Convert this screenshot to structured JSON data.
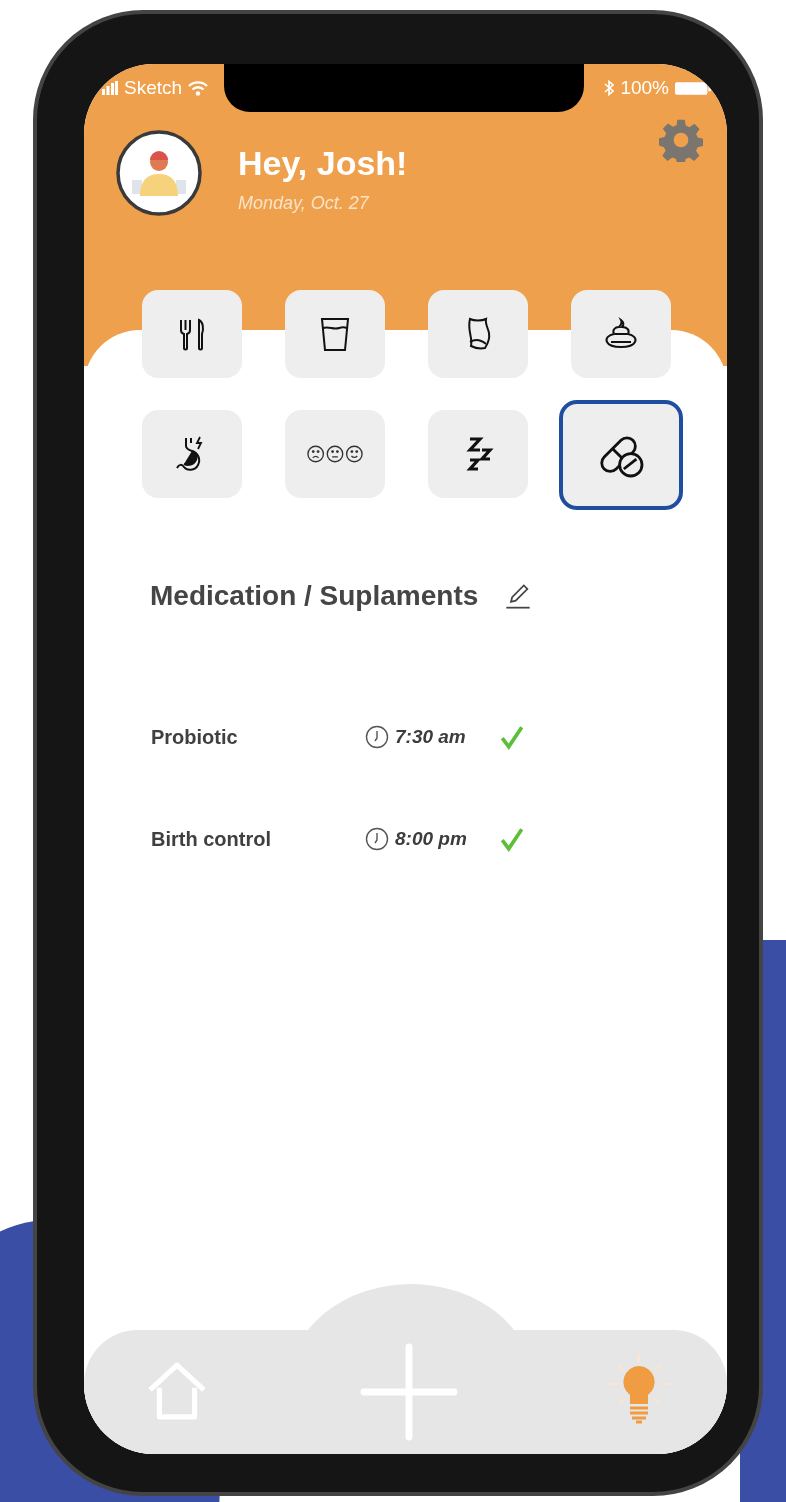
{
  "status_bar": {
    "carrier": "Sketch",
    "battery": "100%"
  },
  "header": {
    "greeting": "Hey, Josh!",
    "date": "Monday, Oct. 27"
  },
  "categories": [
    {
      "kind": "meals",
      "selected": false
    },
    {
      "kind": "drinks",
      "selected": false
    },
    {
      "kind": "body",
      "selected": false
    },
    {
      "kind": "stool",
      "selected": false
    },
    {
      "kind": "stomach",
      "selected": false
    },
    {
      "kind": "mood",
      "selected": false
    },
    {
      "kind": "sleep",
      "selected": false
    },
    {
      "kind": "pills",
      "selected": true
    }
  ],
  "section": {
    "title": "Medication / Suplaments"
  },
  "medications": [
    {
      "name": "Probiotic",
      "time": "7:30 am",
      "taken": true
    },
    {
      "name": "Birth control",
      "time": "8:00 pm",
      "taken": true
    }
  ]
}
